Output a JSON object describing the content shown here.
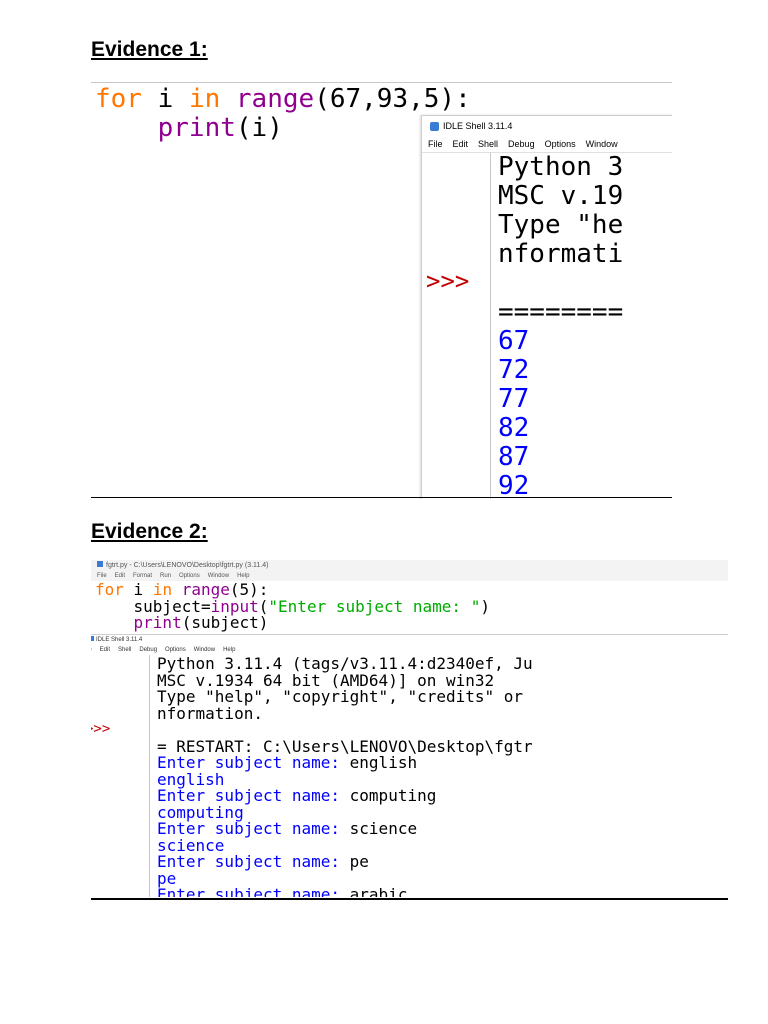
{
  "evidence1": {
    "heading": "Evidence 1:",
    "code_line1": {
      "kw1": "for",
      "var": " i ",
      "kw2": "in",
      "sp": " ",
      "bi": "range",
      "rest": "(67,93,5):"
    },
    "code_line2": {
      "indent": "    ",
      "bi": "print",
      "rest": "(i)"
    },
    "shell": {
      "title": "IDLE Shell 3.11.4",
      "menu": [
        "File",
        "Edit",
        "Shell",
        "Debug",
        "Options",
        "Window"
      ],
      "banner": [
        "Python 3",
        "MSC v.19",
        "Type \"he",
        "nformati"
      ],
      "prompt": ">>>",
      "separator": "========",
      "output": [
        "67",
        "72",
        "77",
        "82",
        "87",
        "92"
      ]
    }
  },
  "evidence2": {
    "heading": "Evidence 2:",
    "editor_title": "fgtrt.py - C:\\Users\\LENOVO\\Desktop\\fgtrt.py (3.11.4)",
    "editor_menu": [
      "File",
      "Edit",
      "Format",
      "Run",
      "Options",
      "Window",
      "Help"
    ],
    "code_line1": {
      "kw1": "for",
      "var": " i ",
      "kw2": "in",
      "sp": " ",
      "bi": "range",
      "rest": "(5):"
    },
    "code_line2": {
      "indent": "    ",
      "pre": "subject=",
      "bi": "input",
      "open": "(",
      "str": "\"Enter subject name: \"",
      "close": ")"
    },
    "code_line3": {
      "indent": "    ",
      "bi": "print",
      "rest": "(subject)"
    },
    "shell": {
      "title": "IDLE Shell 3.11.4",
      "menu": [
        "le",
        "Edit",
        "Shell",
        "Debug",
        "Options",
        "Window",
        "Help"
      ],
      "banner": [
        "Python 3.11.4 (tags/v3.11.4:d2340ef, Ju",
        "MSC v.1934 64 bit (AMD64)] on win32",
        "Type \"help\", \"copyright\", \"credits\" or",
        "nformation."
      ],
      "prompt": ">>>",
      "restart": "= RESTART: C:\\Users\\LENOVO\\Desktop\\fgtr",
      "session": [
        {
          "prompt": "Enter subject name: ",
          "input": "english",
          "echo": "english"
        },
        {
          "prompt": "Enter subject name: ",
          "input": "computing",
          "echo": "computing"
        },
        {
          "prompt": "Enter subject name: ",
          "input": "science",
          "echo": "science"
        },
        {
          "prompt": "Enter subject name: ",
          "input": "pe",
          "echo": "pe"
        },
        {
          "prompt": "Enter subject name: ",
          "input": "arabic"
        }
      ]
    }
  }
}
